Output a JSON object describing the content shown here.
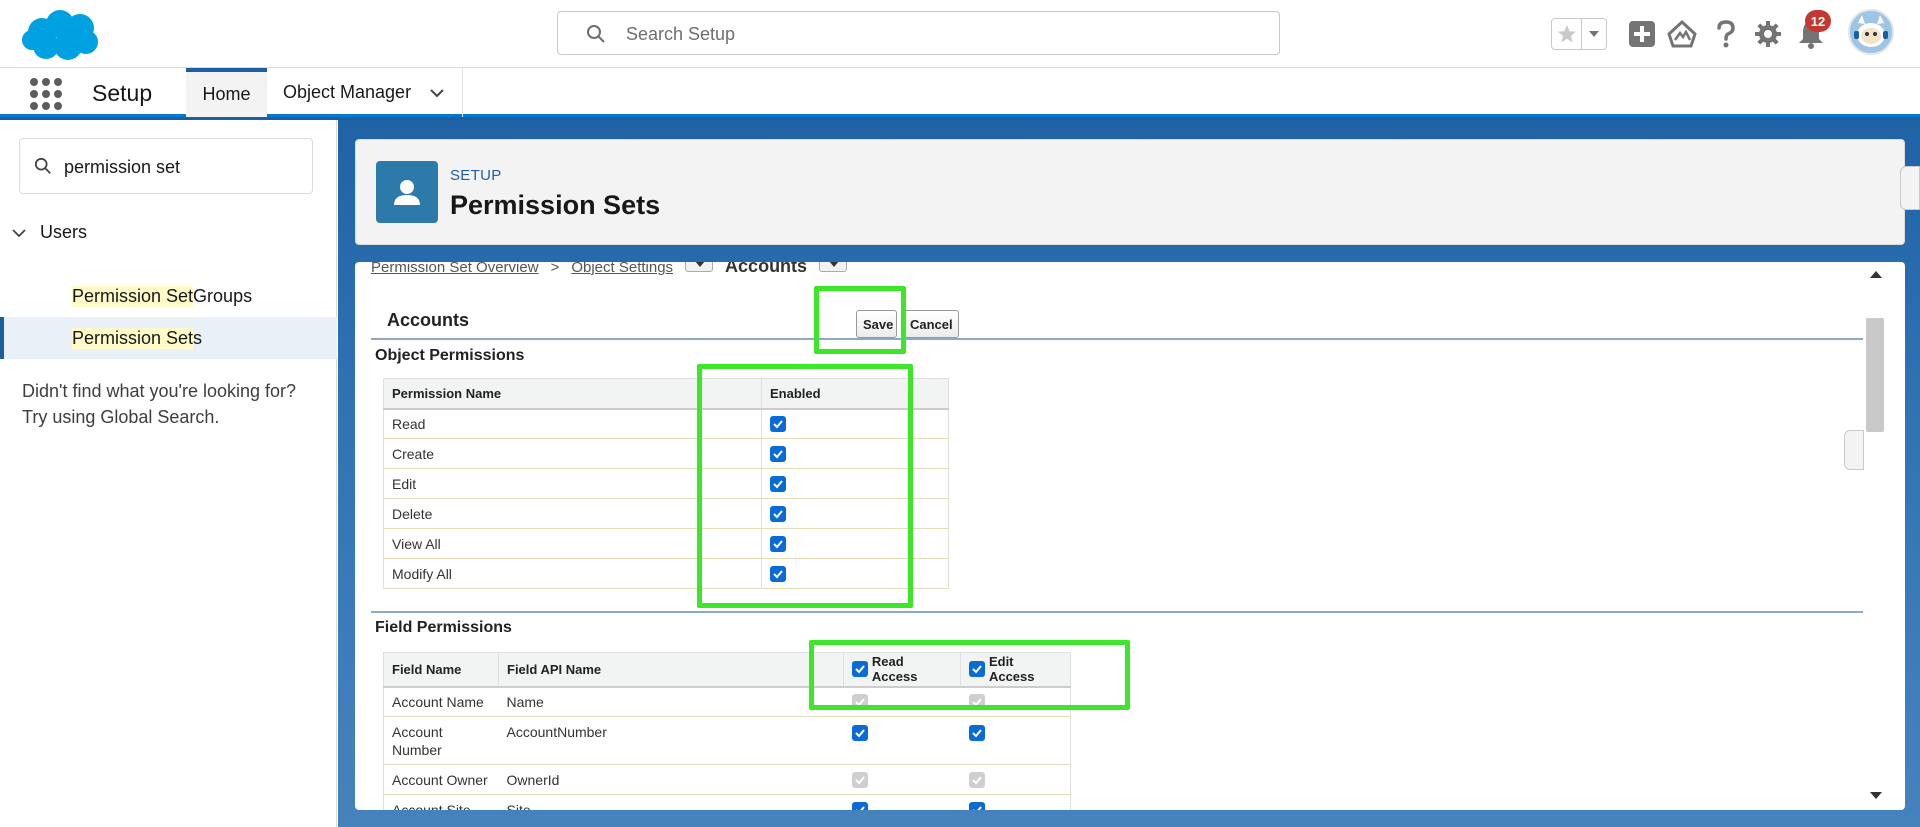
{
  "header": {
    "search_placeholder": "Search Setup",
    "notification_count": "12"
  },
  "nav": {
    "app_name": "Setup",
    "tabs": [
      {
        "label": "Home"
      },
      {
        "label": "Object Manager"
      }
    ]
  },
  "sidebar": {
    "quickfind_value": "permission set",
    "tree_parent": "Users",
    "items": [
      {
        "highlight": "Permission Set",
        "rest": " Groups"
      },
      {
        "highlight": "Permission Set",
        "rest": "s"
      }
    ],
    "not_found_line1": "Didn't find what you're looking for?",
    "not_found_line2": "Try using Global Search."
  },
  "page_header": {
    "eyebrow": "SETUP",
    "title": "Permission Sets"
  },
  "content": {
    "breadcrumb": {
      "link1": "Permission Set Overview",
      "sep": ">",
      "link2": "Object Settings",
      "current": "Accounts"
    },
    "object_title": "Accounts",
    "save_label": "Save",
    "cancel_label": "Cancel",
    "object_permissions": {
      "title": "Object Permissions",
      "headers": [
        "Permission Name",
        "Enabled"
      ],
      "rows": [
        {
          "name": "Read",
          "enabled": true
        },
        {
          "name": "Create",
          "enabled": true
        },
        {
          "name": "Edit",
          "enabled": true
        },
        {
          "name": "Delete",
          "enabled": true
        },
        {
          "name": "View All",
          "enabled": true
        },
        {
          "name": "Modify All",
          "enabled": true
        }
      ]
    },
    "field_permissions": {
      "title": "Field Permissions",
      "headers": [
        "Field Name",
        "Field API Name",
        "Read Access",
        "Edit Access"
      ],
      "rows": [
        {
          "name": "Account Name",
          "api": "Name"
        },
        {
          "name": "Account Number",
          "api": "AccountNumber"
        },
        {
          "name": "Account Owner",
          "api": "OwnerId"
        },
        {
          "name": "Account Site",
          "api": "Site"
        }
      ]
    }
  },
  "colors": {
    "brand_blue": "#0176d3",
    "highlight_green": "#3ee62b",
    "checkbox_blue": "#0b6bd6"
  }
}
